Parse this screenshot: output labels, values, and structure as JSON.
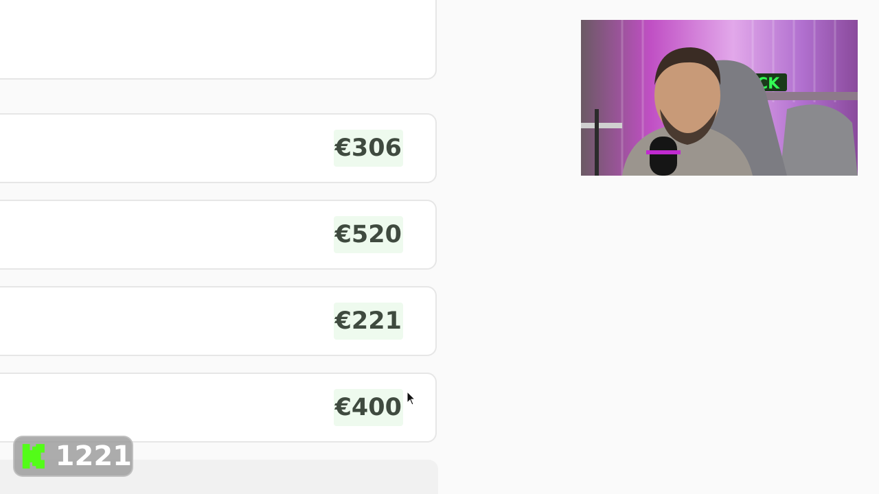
{
  "rows": [
    {
      "price": "€306"
    },
    {
      "price": "€520"
    },
    {
      "price": "€221"
    },
    {
      "price": "€400"
    }
  ],
  "kick_badge": {
    "icon": "kick-logo-icon",
    "count": "1221"
  },
  "colors": {
    "page_bg": "#fafafa",
    "price_badge_bg": "#eefaee",
    "price_text": "#3f4a3f",
    "kick_green": "#53fc18"
  }
}
